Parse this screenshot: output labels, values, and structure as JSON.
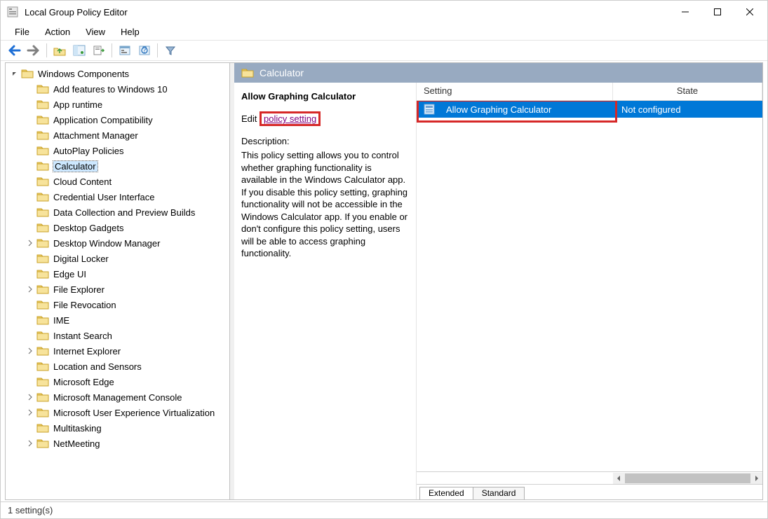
{
  "window": {
    "title": "Local Group Policy Editor"
  },
  "menu": {
    "items": [
      "File",
      "Action",
      "View",
      "Help"
    ]
  },
  "toolbar": {
    "buttons": [
      {
        "name": "back-icon",
        "kind": "arrow-left",
        "color": "#1e6fd6"
      },
      {
        "name": "forward-icon",
        "kind": "arrow-right",
        "color": "#808080"
      },
      {
        "sep": true
      },
      {
        "name": "up-icon",
        "kind": "folder-up"
      },
      {
        "name": "show-hide-tree-icon",
        "kind": "console-tree"
      },
      {
        "name": "export-icon",
        "kind": "export-list"
      },
      {
        "sep": true
      },
      {
        "name": "properties-icon",
        "kind": "properties"
      },
      {
        "name": "help-icon",
        "kind": "help"
      },
      {
        "sep": true
      },
      {
        "name": "filter-icon",
        "kind": "filter"
      }
    ]
  },
  "tree": {
    "root_label": "Windows Components",
    "items": [
      {
        "label": "Add features to Windows 10",
        "expandable": false
      },
      {
        "label": "App runtime",
        "expandable": false
      },
      {
        "label": "Application Compatibility",
        "expandable": false
      },
      {
        "label": "Attachment Manager",
        "expandable": false
      },
      {
        "label": "AutoPlay Policies",
        "expandable": false
      },
      {
        "label": "Calculator",
        "expandable": false,
        "selected": true
      },
      {
        "label": "Cloud Content",
        "expandable": false
      },
      {
        "label": "Credential User Interface",
        "expandable": false
      },
      {
        "label": "Data Collection and Preview Builds",
        "expandable": false
      },
      {
        "label": "Desktop Gadgets",
        "expandable": false
      },
      {
        "label": "Desktop Window Manager",
        "expandable": true
      },
      {
        "label": "Digital Locker",
        "expandable": false
      },
      {
        "label": "Edge UI",
        "expandable": false
      },
      {
        "label": "File Explorer",
        "expandable": true
      },
      {
        "label": "File Revocation",
        "expandable": false
      },
      {
        "label": "IME",
        "expandable": false
      },
      {
        "label": "Instant Search",
        "expandable": false
      },
      {
        "label": "Internet Explorer",
        "expandable": true
      },
      {
        "label": "Location and Sensors",
        "expandable": false
      },
      {
        "label": "Microsoft Edge",
        "expandable": false
      },
      {
        "label": "Microsoft Management Console",
        "expandable": true
      },
      {
        "label": "Microsoft User Experience Virtualization",
        "expandable": true
      },
      {
        "label": "Multitasking",
        "expandable": false
      },
      {
        "label": "NetMeeting",
        "expandable": true
      }
    ]
  },
  "details": {
    "header_title": "Calculator",
    "policy_title": "Allow Graphing Calculator",
    "edit_prefix": "Edit",
    "edit_link": "policy setting",
    "description_label": "Description:",
    "description_text": "This policy setting allows you to control whether graphing functionality is available in the Windows Calculator app. If you disable this policy setting, graphing functionality will not be accessible in the Windows Calculator app. If you enable or don't configure this policy setting, users will be able to access graphing functionality.",
    "columns": {
      "setting": "Setting",
      "state": "State"
    },
    "rows": [
      {
        "setting": "Allow Graphing Calculator",
        "state": "Not configured",
        "selected": true
      }
    ],
    "tabs": [
      "Extended",
      "Standard"
    ],
    "active_tab": 0
  },
  "status": {
    "text": "1 setting(s)"
  }
}
